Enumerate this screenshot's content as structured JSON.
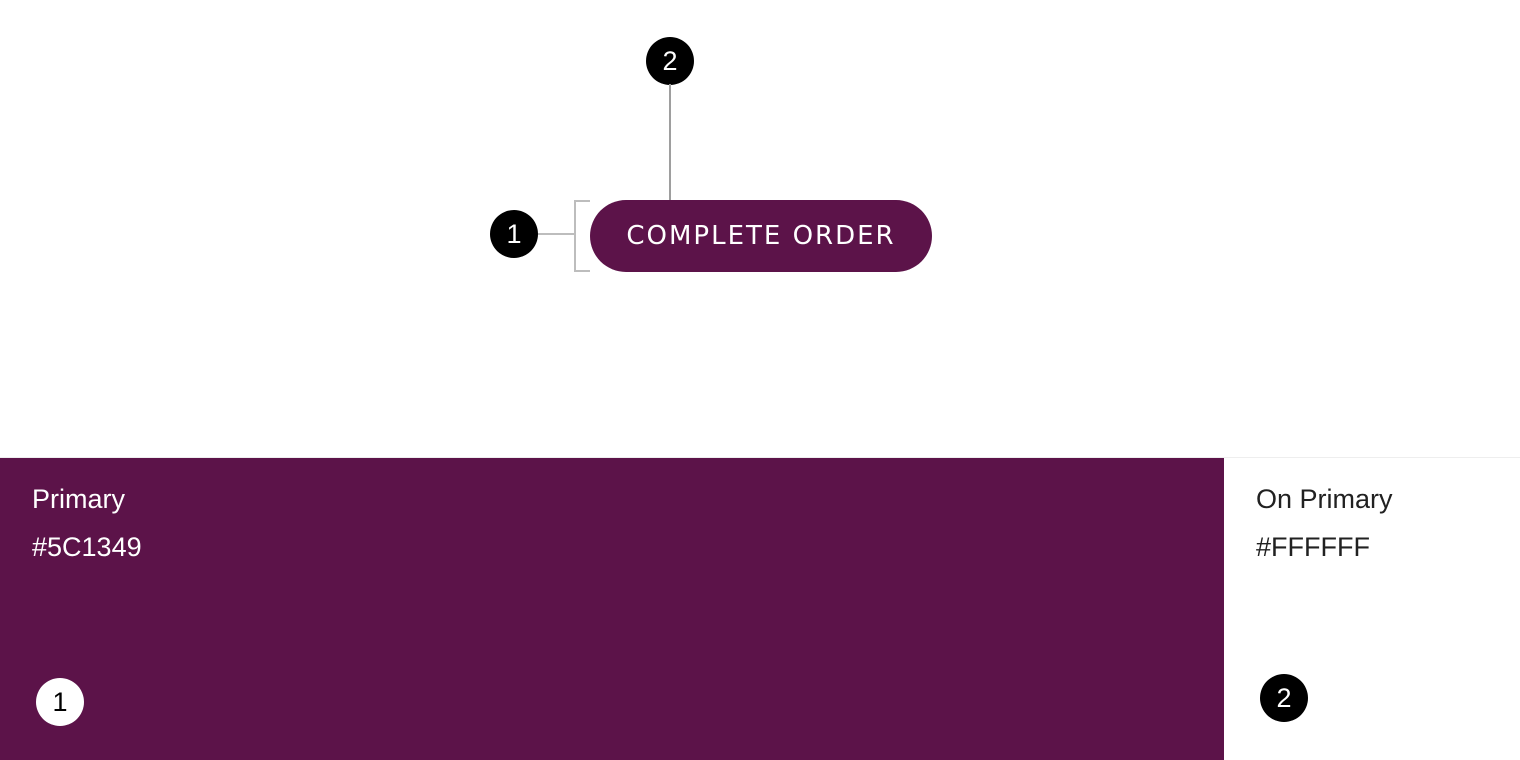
{
  "preview": {
    "button_label": "COMPLETE ORDER",
    "markers": {
      "container": "1",
      "label_text": "2"
    }
  },
  "swatches": [
    {
      "name": "Primary",
      "hex": "#5C1349",
      "marker": "1"
    },
    {
      "name": "On Primary",
      "hex": "#FFFFFF",
      "marker": "2"
    }
  ],
  "colors": {
    "primary": "#5C1349",
    "on_primary": "#FFFFFF",
    "marker": "#000000",
    "leader_line": "#BDBDBD"
  }
}
